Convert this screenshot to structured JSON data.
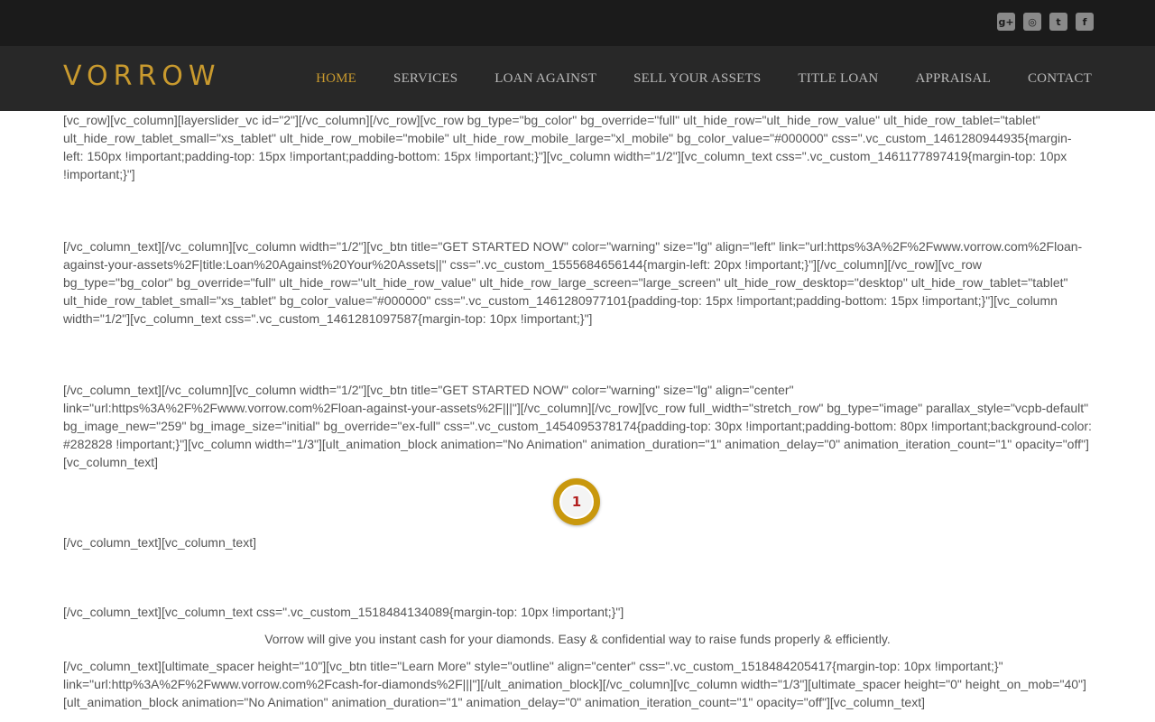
{
  "social": {
    "icons": [
      "google-plus-icon",
      "instagram-icon",
      "twitter-icon",
      "facebook-icon"
    ],
    "glyphs": [
      "g+",
      "◎",
      "t",
      "f"
    ]
  },
  "header": {
    "logo": "VORROW",
    "nav": [
      "HOME",
      "SERVICES",
      "LOAN AGAINST",
      "SELL YOUR ASSETS",
      "TITLE LOAN",
      "APPRAISAL",
      "CONTACT"
    ],
    "active": "HOME"
  },
  "content": {
    "p1": "[vc_row][vc_column][layerslider_vc id=\"2\"][/vc_column][/vc_row][vc_row bg_type=\"bg_color\" bg_override=\"full\" ult_hide_row=\"ult_hide_row_value\" ult_hide_row_tablet=\"tablet\" ult_hide_row_tablet_small=\"xs_tablet\" ult_hide_row_mobile=\"mobile\" ult_hide_row_mobile_large=\"xl_mobile\" bg_color_value=\"#000000\" css=\".vc_custom_1461280944935{margin-left: 150px !important;padding-top: 15px !important;padding-bottom: 15px !important;}\"][vc_column width=\"1/2\"][vc_column_text css=\".vc_custom_1461177897419{margin-top: 10px !important;}\"]",
    "p2": "[/vc_column_text][/vc_column][vc_column width=\"1/2\"][vc_btn title=\"GET STARTED NOW\" color=\"warning\" size=\"lg\" align=\"left\" link=\"url:https%3A%2F%2Fwww.vorrow.com%2Floan-against-your-assets%2F|title:Loan%20Against%20Your%20Assets||\" css=\".vc_custom_1555684656144{margin-left: 20px !important;}\"][/vc_column][/vc_row][vc_row bg_type=\"bg_color\" bg_override=\"full\" ult_hide_row=\"ult_hide_row_value\" ult_hide_row_large_screen=\"large_screen\" ult_hide_row_desktop=\"desktop\" ult_hide_row_tablet=\"tablet\" ult_hide_row_tablet_small=\"xs_tablet\" bg_color_value=\"#000000\" css=\".vc_custom_1461280977101{padding-top: 15px !important;padding-bottom: 15px !important;}\"][vc_column width=\"1/2\"][vc_column_text css=\".vc_custom_1461281097587{margin-top: 10px !important;}\"]",
    "p3": "[/vc_column_text][/vc_column][vc_column width=\"1/2\"][vc_btn title=\"GET STARTED NOW\" color=\"warning\" size=\"lg\" align=\"center\" link=\"url:https%3A%2F%2Fwww.vorrow.com%2Floan-against-your-assets%2F|||\"][/vc_column][/vc_row][vc_row full_width=\"stretch_row\" bg_type=\"image\" parallax_style=\"vcpb-default\" bg_image_new=\"259\" bg_image_size=\"initial\" bg_override=\"ex-full\" css=\".vc_custom_1454095378174{padding-top: 30px !important;padding-bottom: 80px !important;background-color: #282828 !important;}\"][vc_column width=\"1/3\"][ult_animation_block animation=\"No Animation\" animation_duration=\"1\" animation_delay=\"0\" animation_iteration_count=\"1\" opacity=\"off\"][vc_column_text]",
    "p4": "[/vc_column_text][vc_column_text]",
    "p5": "[/vc_column_text][vc_column_text css=\".vc_custom_1518484134089{margin-top: 10px !important;}\"]",
    "p6": "Vorrow will give you instant cash for your diamonds. Easy & confidential way to raise funds properly & efficiently.",
    "p7": "[/vc_column_text][ultimate_spacer height=\"10\"][vc_btn title=\"Learn More\" style=\"outline\" align=\"center\" css=\".vc_custom_1518484205417{margin-top: 10px !important;}\" link=\"url:http%3A%2F%2Fwww.vorrow.com%2Fcash-for-diamonds%2F|||\"][/ult_animation_block][/vc_column][vc_column width=\"1/3\"][ultimate_spacer height=\"0\" height_on_mob=\"40\"][ult_animation_block animation=\"No Animation\" animation_duration=\"1\" animation_delay=\"0\" animation_iteration_count=\"1\" opacity=\"off\"][vc_column_text]"
  },
  "marker": {
    "number": "1"
  },
  "colors": {
    "accent": "#c99a2e",
    "topbar": "#1b1b1b",
    "navbar": "#282828",
    "text": "#555555"
  }
}
